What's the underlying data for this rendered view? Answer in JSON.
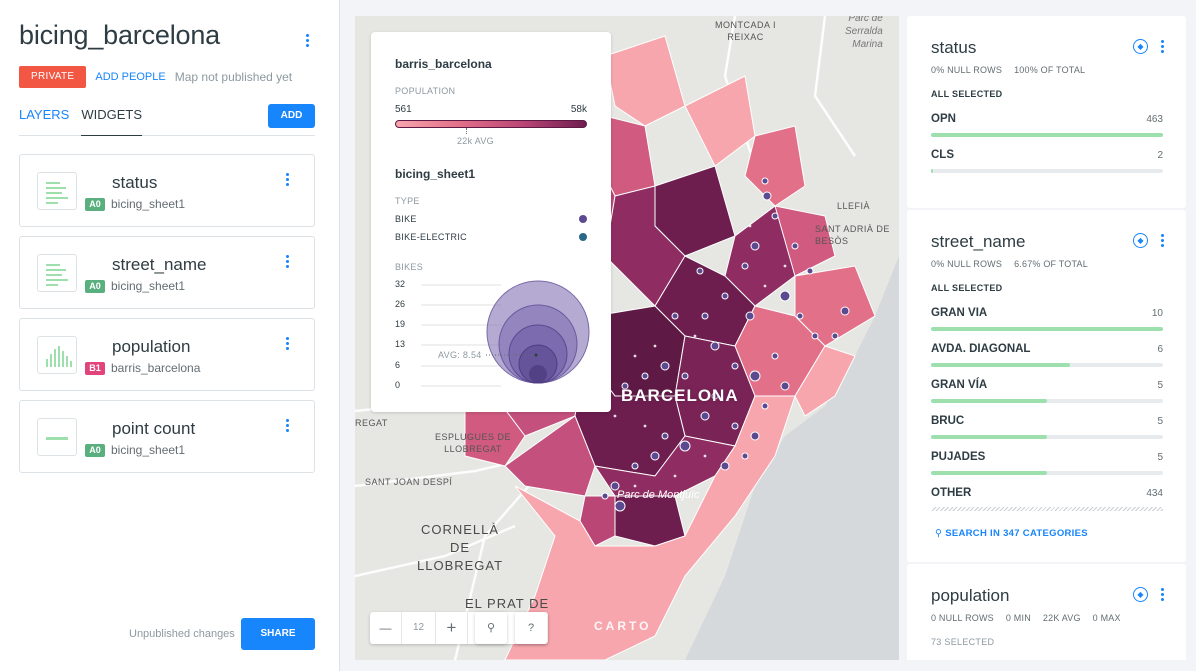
{
  "map_name": "bicing_barcelona",
  "publish": {
    "private_label": "PRIVATE",
    "add_people": "ADD PEOPLE",
    "status": "Map not published yet"
  },
  "tabs": {
    "layers": "LAYERS",
    "widgets": "WIDGETS",
    "add": "ADD"
  },
  "widget_list": [
    {
      "name": "status",
      "badge": "A0",
      "badge_color": "#59b07e",
      "source": "bicing_sheet1",
      "icon": "category-widget-icon"
    },
    {
      "name": "street_name",
      "badge": "A0",
      "badge_color": "#59b07e",
      "source": "bicing_sheet1",
      "icon": "category-widget-icon"
    },
    {
      "name": "population",
      "badge": "B1",
      "badge_color": "#e2437b",
      "source": "barris_barcelona",
      "icon": "histogram-widget-icon"
    },
    {
      "name": "point count",
      "badge": "A0",
      "badge_color": "#59b07e",
      "source": "bicing_sheet1",
      "icon": "formula-widget-icon"
    }
  ],
  "footer": {
    "unpublished": "Unpublished changes",
    "share": "SHARE"
  },
  "legend": {
    "layer1": {
      "title": "barris_barcelona",
      "attr": "POPULATION",
      "min": "561",
      "max": "58k",
      "avg": "22k AVG",
      "avg_fraction": 0.38
    },
    "layer2": {
      "title": "bicing_sheet1",
      "type_label": "TYPE",
      "types": [
        {
          "label": "BIKE",
          "color": "#5c4a91"
        },
        {
          "label": "BIKE-ELECTRIC",
          "color": "#2b6787"
        }
      ],
      "size_label": "BIKES",
      "ticks": [
        "32",
        "26",
        "19",
        "13",
        "6",
        "0"
      ],
      "avg_label": "AVG: 8.54"
    }
  },
  "map_labels": {
    "city": "BARCELONA",
    "montcada": "MONTCADA I\nREIXAC",
    "serrald": "Parc de\nSerralda\nMarina",
    "llefia": "LLEFIÀ",
    "santadria": "SANT ADRIÀ DE\nBESÒS",
    "esplugues": "ESPLUGUES DE\nLLOBREGAT",
    "sjd": "SANT JOAN DESPÍ",
    "cornella": "CORNELLÀ\nDE\nLLOBREGAT",
    "prat": "EL PRAT DE",
    "montjuic": "Parc de Montjuïc",
    "regat": "REGAT",
    "carto": "CARTO"
  },
  "map_controls": {
    "zoom_out": "—",
    "zoom_level": "12",
    "zoom_in": "+",
    "search": "⚲",
    "help": "?"
  },
  "widgets": {
    "status": {
      "title": "status",
      "meta": [
        "0% NULL ROWS",
        "100% OF TOTAL"
      ],
      "selected": "ALL SELECTED",
      "categories": [
        {
          "label": "OPN",
          "count": "463",
          "fraction": 1.0
        },
        {
          "label": "CLS",
          "count": "2",
          "fraction": 0.01
        }
      ]
    },
    "street_name": {
      "title": "street_name",
      "meta": [
        "0% NULL ROWS",
        "6.67% OF TOTAL"
      ],
      "selected": "ALL SELECTED",
      "categories": [
        {
          "label": "GRAN VIA",
          "count": "10",
          "fraction": 1.0
        },
        {
          "label": "AVDA. DIAGONAL",
          "count": "6",
          "fraction": 0.6
        },
        {
          "label": "GRAN VÍA",
          "count": "5",
          "fraction": 0.5
        },
        {
          "label": "BRUC",
          "count": "5",
          "fraction": 0.5
        },
        {
          "label": "PUJADES",
          "count": "5",
          "fraction": 0.5
        },
        {
          "label": "OTHER",
          "count": "434",
          "fraction": 0
        }
      ],
      "search": "SEARCH IN 347 CATEGORIES"
    },
    "population": {
      "title": "population",
      "meta": [
        "0 NULL ROWS",
        "0 MIN",
        "22K AVG",
        "0 MAX"
      ],
      "selected": "73 SELECTED"
    }
  }
}
